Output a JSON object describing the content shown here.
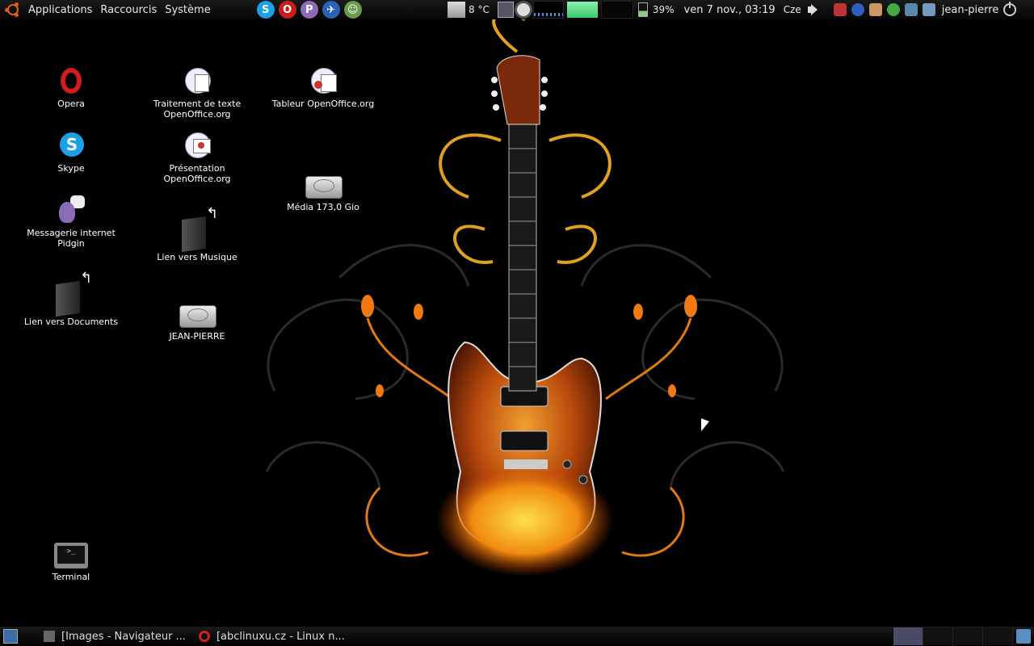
{
  "top_panel": {
    "menus": [
      "Applications",
      "Raccourcis",
      "Système"
    ],
    "launchers": [
      {
        "icon": "skype-icon",
        "color": "#1aa0e6",
        "glyph": "S"
      },
      {
        "icon": "opera-icon",
        "color": "#cc1b1b",
        "glyph": "O"
      },
      {
        "icon": "pidgin-icon",
        "color": "#8a6bb8",
        "glyph": "P"
      },
      {
        "icon": "browser-icon",
        "color": "#2a62b8",
        "glyph": "✈"
      },
      {
        "icon": "contacts-icon",
        "color": "#6a9a4a",
        "glyph": "☺"
      }
    ],
    "temperature": "8 °C",
    "battery": "39%",
    "clock": "ven   7 nov., 03:19",
    "keyboard_layout": "Cze",
    "user": "jean-pierre"
  },
  "desktop_icons": [
    {
      "name": "opera",
      "label": "Opera",
      "icon": "opera-icon"
    },
    {
      "name": "skype",
      "label": "Skype",
      "icon": "skype-icon"
    },
    {
      "name": "pidgin",
      "label": "Messagerie internet\nPidgin",
      "icon": "pidgin-icon"
    },
    {
      "name": "documents-link",
      "label": "Lien vers Documents",
      "icon": "folder-link-icon"
    },
    {
      "name": "terminal",
      "label": "Terminal",
      "icon": "terminal-icon"
    },
    {
      "name": "writer",
      "label": "Traitement de texte\nOpenOffice.org",
      "icon": "writer-icon"
    },
    {
      "name": "impress",
      "label": "Présentation\nOpenOffice.org",
      "icon": "impress-icon"
    },
    {
      "name": "music-link",
      "label": "Lien vers Musique",
      "icon": "folder-link-icon"
    },
    {
      "name": "jean-pierre-drive",
      "label": "JEAN-PIERRE",
      "icon": "drive-icon"
    },
    {
      "name": "calc",
      "label": "Tableur OpenOffice.org",
      "icon": "calc-icon"
    },
    {
      "name": "media-drive",
      "label": "Média 173,0 Gio",
      "icon": "drive-icon"
    }
  ],
  "taskbar": {
    "tasks": [
      "[Images - Navigateur ...",
      "[abclinuxu.cz - Linux n..."
    ]
  },
  "colors": {
    "panel": "#0d0d0d",
    "accent_orange": "#e05d1b"
  }
}
